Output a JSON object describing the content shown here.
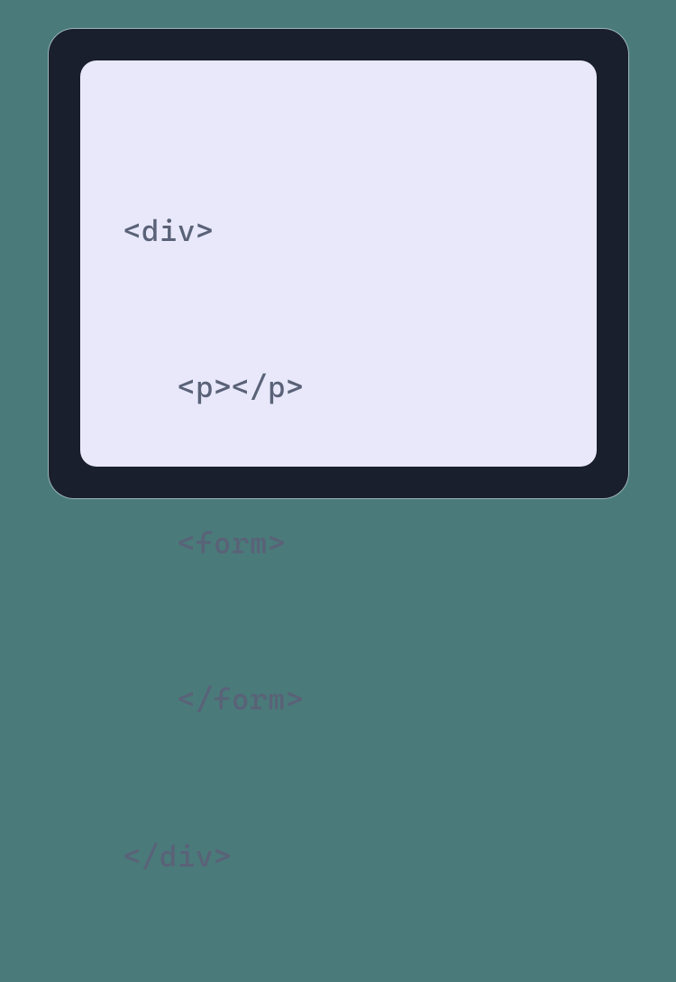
{
  "code": {
    "lines": [
      {
        "text": "<div>",
        "indent": 0
      },
      {
        "text": "<p></p>",
        "indent": 1
      },
      {
        "text": "<form>",
        "indent": 1
      },
      {
        "text": "</form>",
        "indent": 1
      },
      {
        "text": "</div>",
        "indent": 0
      }
    ]
  }
}
